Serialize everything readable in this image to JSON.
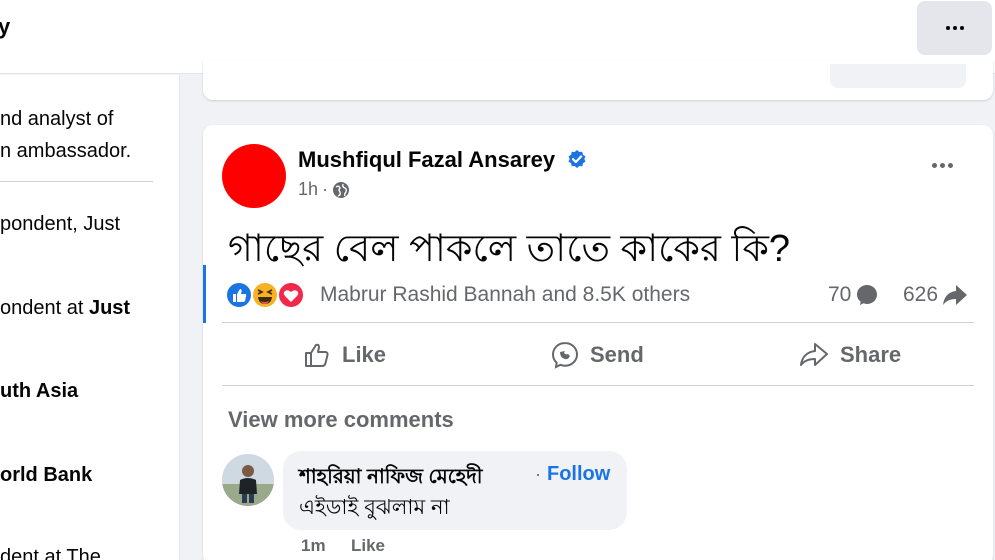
{
  "header": {
    "title_fragment": "y",
    "more_icon": "more-dots-icon"
  },
  "left_panel": {
    "intro_line1": "nd analyst of",
    "intro_line2": "n ambassador.",
    "items": [
      {
        "prefix": "pondent, Just",
        "bold": ""
      },
      {
        "prefix": "ondent at ",
        "bold": "Just"
      },
      {
        "prefix": "",
        "bold": "uth Asia"
      },
      {
        "prefix": "",
        "bold": "orld Bank"
      },
      {
        "prefix": "dent at The",
        "bold": ""
      }
    ]
  },
  "post": {
    "author": "Mushfiqul Fazal Ansarey",
    "time": "1h",
    "separator": "·",
    "audience_icon": "globe-icon",
    "text": "গাছের বেল পাকলে তাতে কাকের কি?",
    "reactions": {
      "icons": [
        "like-reaction-icon",
        "haha-reaction-icon",
        "love-reaction-icon"
      ],
      "names": "Mabrur Rashid Bannah and 8.5K others",
      "comments_count": "70",
      "shares_count": "626"
    },
    "actions": {
      "like": "Like",
      "send": "Send",
      "share": "Share"
    },
    "view_more_comments": "View more comments",
    "comment": {
      "author": "শাহরিয়া নাফিজ মেহেদী",
      "dot": "·",
      "follow": "Follow",
      "text": "এইডাই বুঝলাম না",
      "time": "1m",
      "like": "Like"
    }
  },
  "colors": {
    "accent": "#1b74e4",
    "avatar": "#ff0000",
    "secondary_text": "#65676b",
    "background": "#f0f2f5"
  }
}
